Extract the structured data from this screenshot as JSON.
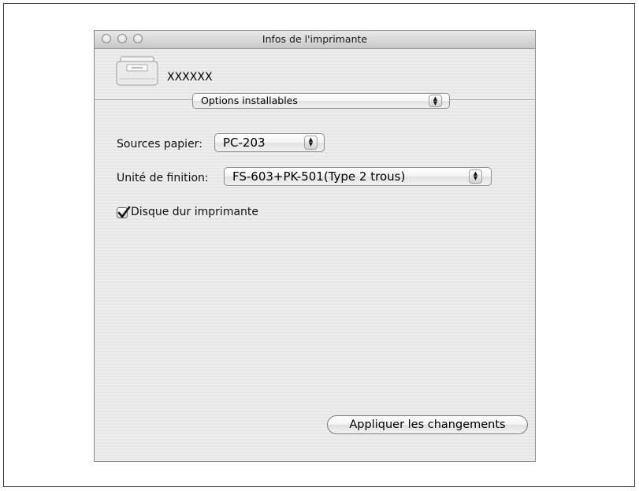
{
  "window": {
    "title": "Infos de l'imprimante"
  },
  "printer": {
    "name": "XXXXXX",
    "icon": "printer-icon"
  },
  "section_popup": {
    "selected": "Options installables"
  },
  "paper_sources": {
    "label": "Sources papier:",
    "selected": "PC-203"
  },
  "finisher": {
    "label": "Unité de finition:",
    "selected": "FS-603+PK-501(Type 2 trous)"
  },
  "hard_disk": {
    "label": "Disque dur imprimante",
    "checked": true
  },
  "apply_button": {
    "label": "Appliquer les changements"
  },
  "icons": {
    "popup_arrows": "updown-arrows-icon",
    "check": "checkmark-icon"
  }
}
